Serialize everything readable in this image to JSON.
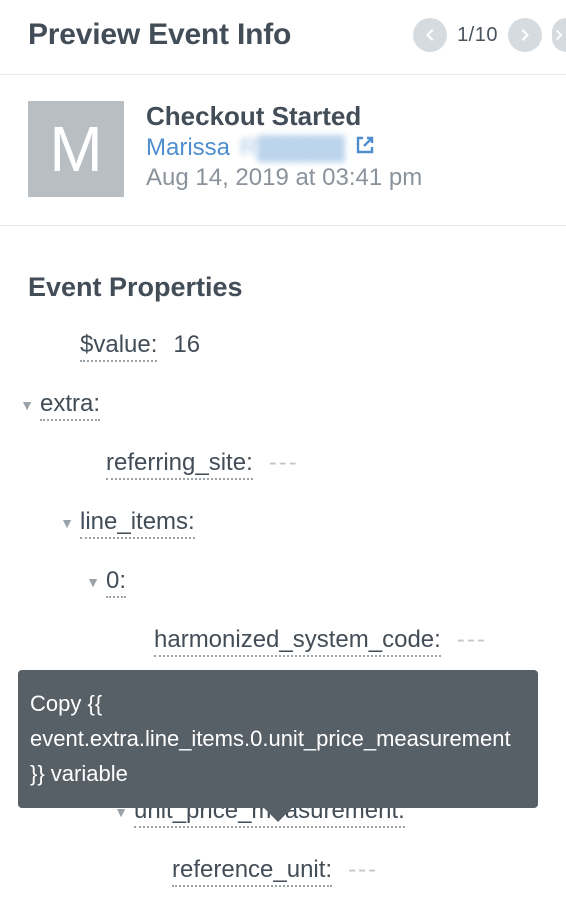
{
  "header": {
    "title": "Preview Event Info",
    "counter": "1/10"
  },
  "event": {
    "avatar_initial": "M",
    "name": "Checkout Started",
    "user_first": "Marissa",
    "user_last_obscured": "R▓▓▓▓▓",
    "timestamp": "Aug 14, 2019 at 03:41 pm"
  },
  "section_title": "Event Properties",
  "props": {
    "value_key": "$value:",
    "value_val": "16",
    "extra_key": "extra:",
    "referring_site_key": "referring_site:",
    "referring_site_val": "---",
    "line_items_key": "line_items:",
    "idx0_key": "0:",
    "hsc_key": "harmonized_system_code:",
    "hsc_val": "---",
    "upm_key": "unit_price_measurement:",
    "ref_unit_key": "reference_unit:",
    "ref_unit_val": "---"
  },
  "tooltip": {
    "text": "Copy {{ event.extra.line_items.0.unit_price_measurement }} variable"
  }
}
